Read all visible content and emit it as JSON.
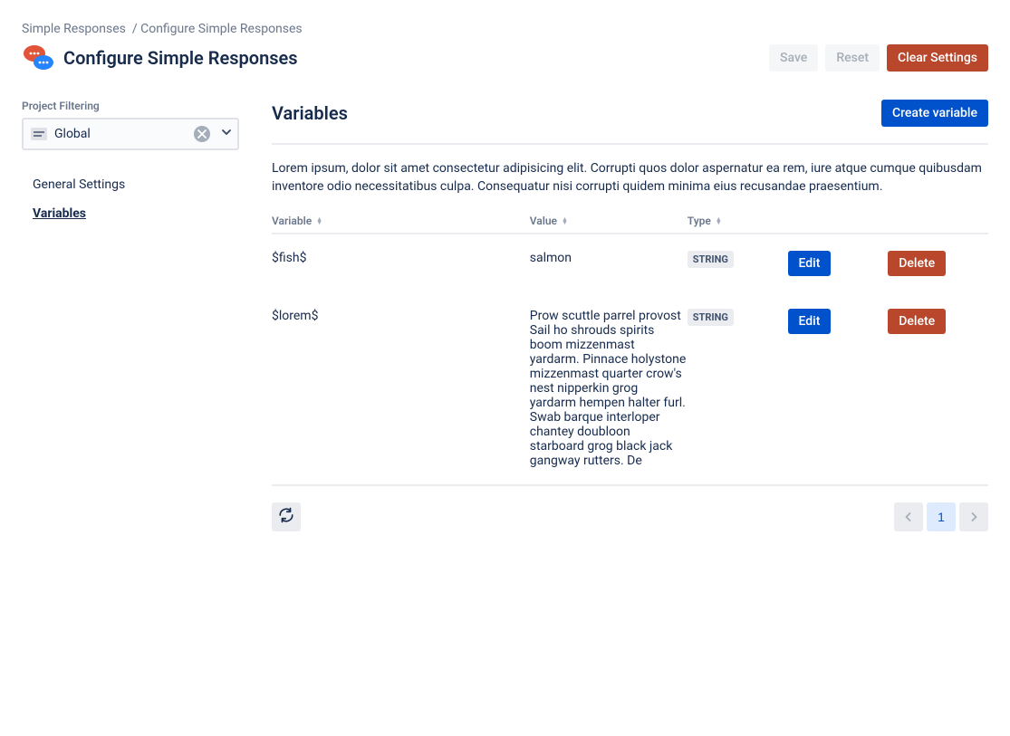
{
  "breadcrumb": {
    "root": "Simple Responses",
    "current": "Configure Simple Responses"
  },
  "page_title": "Configure Simple Responses",
  "header_actions": {
    "save": "Save",
    "reset": "Reset",
    "clear": "Clear Settings"
  },
  "sidebar": {
    "filter_label": "Project Filtering",
    "filter_value": "Global",
    "nav": [
      {
        "label": "General Settings",
        "active": false
      },
      {
        "label": "Variables",
        "active": true
      }
    ]
  },
  "section": {
    "title": "Variables",
    "create_label": "Create variable",
    "description": "Lorem ipsum, dolor sit amet consectetur adipisicing elit. Corrupti quos dolor aspernatur ea rem, iure atque cumque quibusdam inventore odio necessitatibus culpa. Consequatur nisi corrupti quidem minima eius recusandae praesentium."
  },
  "table": {
    "columns": {
      "variable": "Variable",
      "value": "Value",
      "type": "Type"
    },
    "edit_label": "Edit",
    "delete_label": "Delete",
    "rows": [
      {
        "variable": "$fish$",
        "value": "salmon",
        "type": "STRING"
      },
      {
        "variable": "$lorem$",
        "value": "Prow scuttle parrel provost Sail ho shrouds spirits boom mizzenmast yardarm. Pinnace holystone mizzenmast quarter crow's nest nipperkin grog yardarm hempen halter furl. Swab barque interloper chantey doubloon starboard grog black jack gangway rutters. De",
        "type": "STRING"
      }
    ]
  },
  "pagination": {
    "current": "1"
  }
}
